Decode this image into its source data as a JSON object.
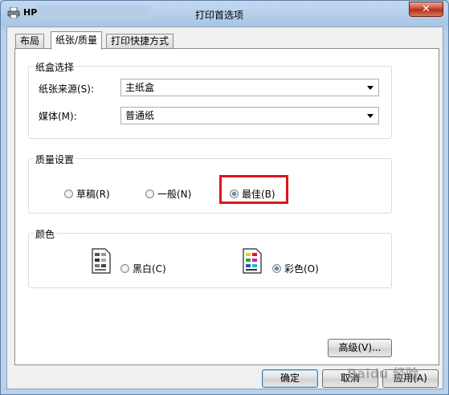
{
  "window": {
    "app_name": "HP",
    "title": "打印首选项",
    "close_glyph": "✕"
  },
  "tabs": [
    {
      "label": "布局",
      "active": false
    },
    {
      "label": "纸张/质量",
      "active": true
    },
    {
      "label": "打印快捷方式",
      "active": false
    }
  ],
  "tray_group": {
    "title": "纸盒选择",
    "source_label": "纸张来源(S):",
    "source_value": "主纸盒",
    "media_label": "媒体(M):",
    "media_value": "普通纸"
  },
  "quality_group": {
    "title": "质量设置",
    "options": [
      {
        "label": "草稿(R)",
        "selected": false
      },
      {
        "label": "一般(N)",
        "selected": false
      },
      {
        "label": "最佳(B)",
        "selected": true
      }
    ],
    "highlight_color": "#e0141e"
  },
  "color_group": {
    "title": "颜色",
    "options": [
      {
        "label": "黑白(C)",
        "selected": false,
        "icon": "grayscale-document-icon"
      },
      {
        "label": "彩色(O)",
        "selected": true,
        "icon": "color-document-icon"
      }
    ]
  },
  "buttons": {
    "advanced": "高级(V)...",
    "ok": "确定",
    "cancel": "取消",
    "apply": "应用(A)"
  },
  "watermark": "Baidu 经验"
}
